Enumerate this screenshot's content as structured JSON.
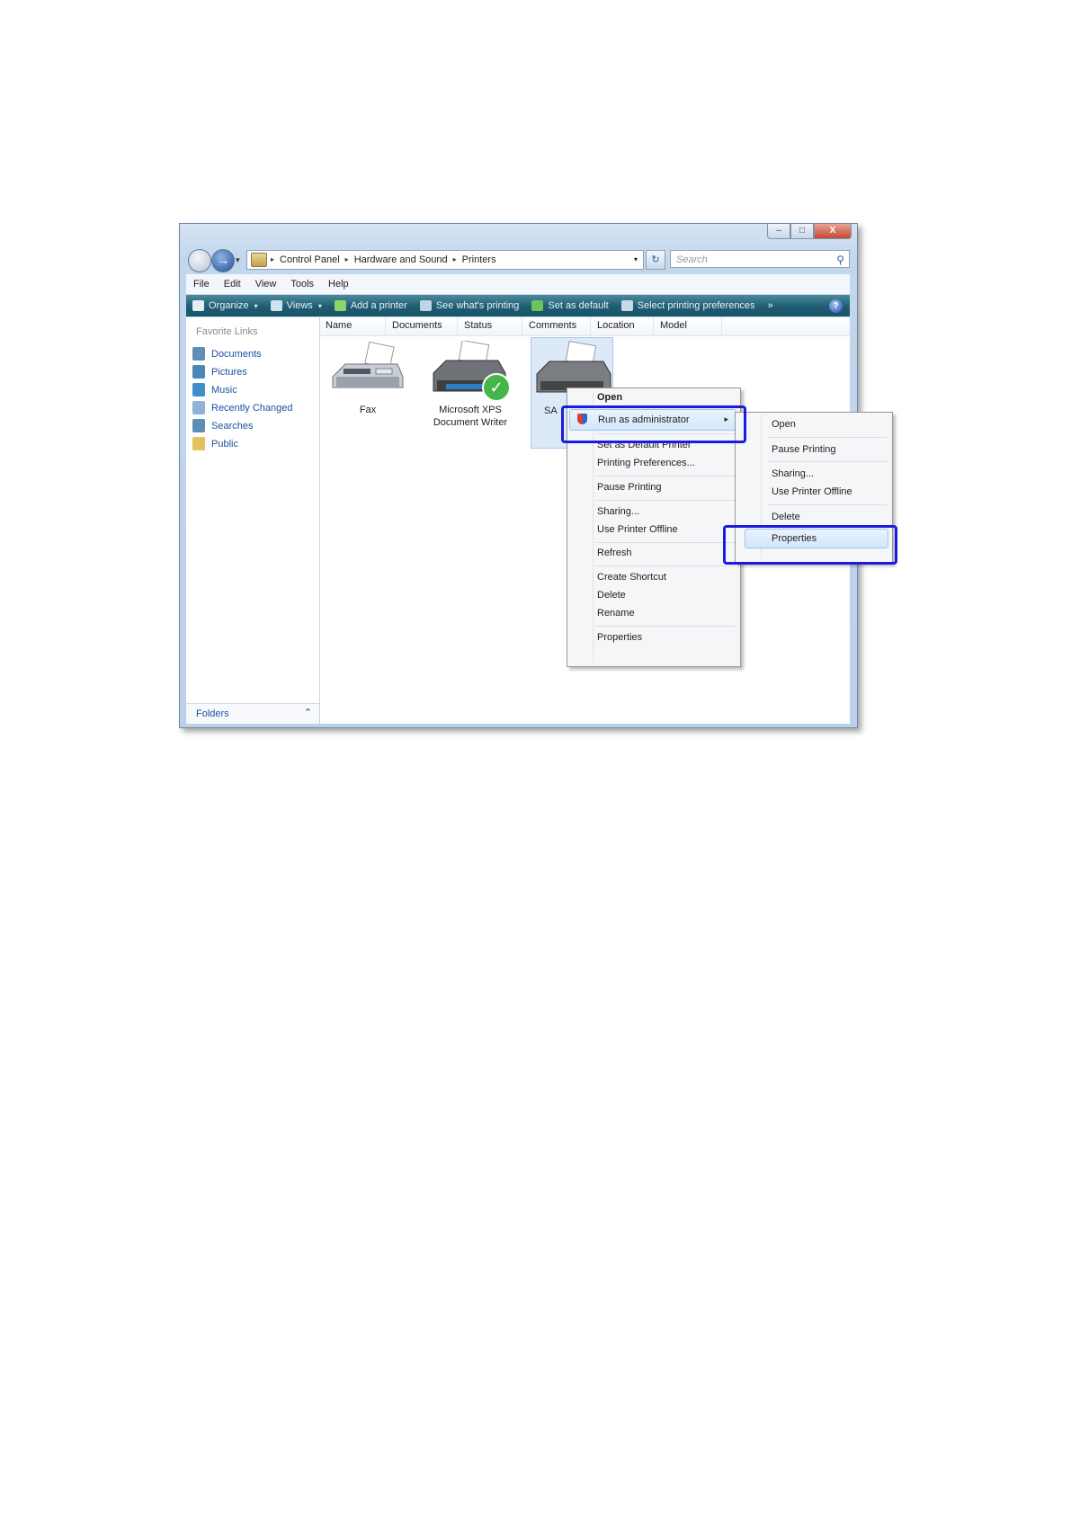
{
  "window": {
    "controls": {
      "minimize": "–",
      "maximize": "□",
      "close": "X"
    }
  },
  "nav": {
    "back_icon": "back-arrow-icon",
    "forward_icon": "forward-arrow-icon",
    "forward_glyph": "→",
    "history_glyph": "▾"
  },
  "address": {
    "sep": "▸",
    "crumbs": [
      "Control Panel",
      "Hardware and Sound",
      "Printers"
    ],
    "dropdown_glyph": "▾",
    "refresh_glyph": "↻"
  },
  "search": {
    "placeholder": "Search",
    "icon": "⚲"
  },
  "menubar": {
    "items": [
      "File",
      "Edit",
      "View",
      "Tools",
      "Help"
    ]
  },
  "toolbar": {
    "items": [
      {
        "label": "Organize",
        "icon": "organize-icon",
        "arrow": "▾",
        "color": "#e6eef4"
      },
      {
        "label": "Views",
        "icon": "views-icon",
        "arrow": "▾",
        "color": "#cfe3ee"
      },
      {
        "label": "Add a printer",
        "icon": "add-printer-icon",
        "color": "#8fd36b"
      },
      {
        "label": "See what's printing",
        "icon": "print-queue-icon",
        "color": "#bcd6e6"
      },
      {
        "label": "Set as default",
        "icon": "set-default-icon",
        "color": "#6dc45a"
      },
      {
        "label": "Select printing preferences",
        "icon": "preferences-icon",
        "color": "#c7dbe7"
      }
    ],
    "more": "»",
    "help": "?"
  },
  "leftpane": {
    "title": "Favorite Links",
    "links": [
      {
        "label": "Documents",
        "icon": "documents-icon",
        "color": "#5d8fb8"
      },
      {
        "label": "Pictures",
        "icon": "pictures-icon",
        "color": "#4b88b8"
      },
      {
        "label": "Music",
        "icon": "music-icon",
        "color": "#3d8fc9"
      },
      {
        "label": "Recently Changed",
        "icon": "recently-changed-icon",
        "color": "#8fb3d8"
      },
      {
        "label": "Searches",
        "icon": "searches-icon",
        "color": "#5c8db5"
      },
      {
        "label": "Public",
        "icon": "public-icon",
        "color": "#e2c25a"
      }
    ],
    "folders": "Folders",
    "folders_chevron": "⌃"
  },
  "columns": [
    "Name",
    "Documents",
    "Status",
    "Comments",
    "Location",
    "Model"
  ],
  "printers": [
    {
      "name": "Fax",
      "line2": ""
    },
    {
      "name": "Microsoft XPS",
      "line2": "Document Writer",
      "badge": "✓"
    },
    {
      "name": "SA",
      "line2": ""
    }
  ],
  "context_menu": {
    "items": [
      "Open",
      "Run as administrator",
      "Set as Default Printer",
      "Printing Preferences...",
      "Pause Printing",
      "Sharing...",
      "Use Printer Offline",
      "Refresh",
      "Create Shortcut",
      "Delete",
      "Rename",
      "Properties"
    ],
    "submenu_arrow": "▸"
  },
  "submenu": {
    "items": [
      "Open",
      "Pause Printing",
      "Sharing...",
      "Use Printer Offline",
      "Delete",
      "Properties"
    ]
  },
  "highlight_color": "#1c1ce0"
}
